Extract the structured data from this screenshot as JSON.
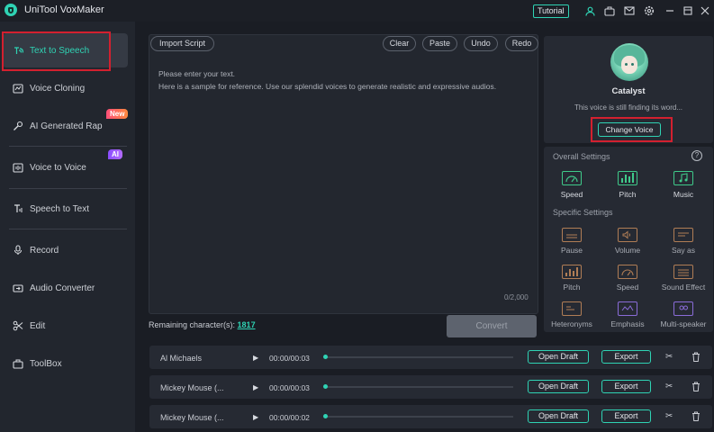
{
  "app": {
    "title": "UniTool VoxMaker",
    "tutorial": "Tutorial"
  },
  "sidebar": {
    "items": [
      {
        "label": "Text to Speech",
        "icon": "text-to-speech-icon"
      },
      {
        "label": "Voice Cloning",
        "icon": "voice-cloning-icon"
      },
      {
        "label": "AI Generated Rap",
        "icon": "rap-icon",
        "badge": "New"
      },
      {
        "label": "Voice to Voice",
        "icon": "voice-to-voice-icon",
        "badge": "AI"
      },
      {
        "label": "Speech to Text",
        "icon": "speech-to-text-icon"
      },
      {
        "label": "Record",
        "icon": "record-icon"
      },
      {
        "label": "Audio Converter",
        "icon": "converter-icon"
      },
      {
        "label": "Edit",
        "icon": "edit-icon"
      },
      {
        "label": "ToolBox",
        "icon": "toolbox-icon"
      }
    ]
  },
  "editor": {
    "import": "Import Script",
    "clear": "Clear",
    "paste": "Paste",
    "undo": "Undo",
    "redo": "Redo",
    "placeholder_line1": "Please enter your text.",
    "placeholder_line2": "Here is a sample for reference. Use our splendid voices to generate realistic and expressive audios.",
    "char_count": "0/2,000",
    "remaining_label": "Remaining character(s): ",
    "remaining_value": "1817",
    "convert": "Convert"
  },
  "voice": {
    "name": "Catalyst",
    "subtitle": "This voice is still finding its word...",
    "change": "Change Voice"
  },
  "settings": {
    "overall_title": "Overall Settings",
    "overall": [
      {
        "label": "Speed"
      },
      {
        "label": "Pitch"
      },
      {
        "label": "Music"
      }
    ],
    "specific_title": "Specific Settings",
    "specific": [
      {
        "label": "Pause"
      },
      {
        "label": "Volume"
      },
      {
        "label": "Say as"
      },
      {
        "label": "Pitch"
      },
      {
        "label": "Speed"
      },
      {
        "label": "Sound Effect"
      },
      {
        "label": "Heteronyms"
      },
      {
        "label": "Emphasis"
      },
      {
        "label": "Multi-speaker"
      }
    ]
  },
  "tracks": [
    {
      "name": "Al Michaels",
      "time": "00:00/00:03",
      "open": "Open Draft",
      "export": "Export"
    },
    {
      "name": "Mickey Mouse (...",
      "time": "00:00/00:03",
      "open": "Open Draft",
      "export": "Export"
    },
    {
      "name": "Mickey Mouse (...",
      "time": "00:00/00:02",
      "open": "Open Draft",
      "export": "Export"
    }
  ],
  "colors": {
    "accent": "#2fd3b4",
    "highlight": "#d3202f",
    "bg": "#1a1d24"
  }
}
